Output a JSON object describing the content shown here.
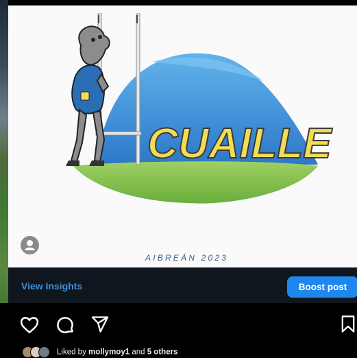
{
  "post": {
    "image": {
      "logo_text": "CUAILLE",
      "date_text": "AIBREÁN 2023"
    },
    "insights_link": "View Insights",
    "boost_button": "Boost post",
    "likes": {
      "prefix": "Liked by",
      "user": "mollymoy1",
      "joiner": "and",
      "others": "5 others"
    }
  },
  "icons": [
    "like-heart-icon",
    "comment-bubble-icon",
    "share-send-icon",
    "save-bookmark-icon",
    "user-placeholder-icon"
  ],
  "colors": {
    "insights_link": "#3e8fd6",
    "boost_button": "#1f86ee",
    "logo_text": "#f3dc55",
    "dome_blue": "#3a8ad6",
    "grass_green": "#7cc04a"
  }
}
